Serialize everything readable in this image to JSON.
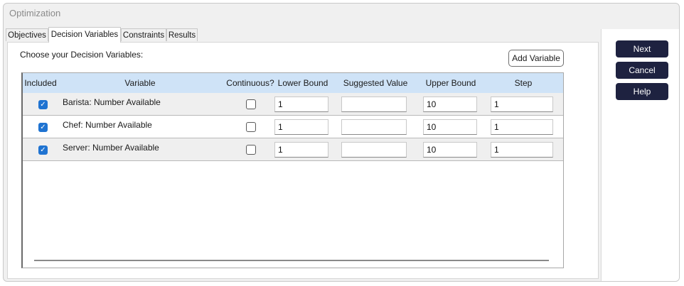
{
  "window": {
    "title": "Optimization"
  },
  "tabs": [
    {
      "label": "Objectives",
      "active": false
    },
    {
      "label": "Decision Variables",
      "active": true
    },
    {
      "label": "Constraints",
      "active": false
    },
    {
      "label": "Results",
      "active": false
    }
  ],
  "panel": {
    "heading": "Choose your Decision Variables:",
    "add_button": "Add Variable"
  },
  "grid": {
    "columns": [
      "Included",
      "Variable",
      "Continuous?",
      "Lower Bound",
      "Suggested Value",
      "Upper Bound",
      "Step"
    ],
    "rows": [
      {
        "included": true,
        "variable": "Barista: Number Available",
        "continuous": false,
        "lower": "1",
        "suggested": "",
        "upper": "10",
        "step": "1"
      },
      {
        "included": true,
        "variable": "Chef: Number Available",
        "continuous": false,
        "lower": "1",
        "suggested": "",
        "upper": "10",
        "step": "1"
      },
      {
        "included": true,
        "variable": "Server: Number Available",
        "continuous": false,
        "lower": "1",
        "suggested": "",
        "upper": "10",
        "step": "1"
      }
    ]
  },
  "buttons": {
    "next": "Next",
    "cancel": "Cancel",
    "help": "Help"
  },
  "colors": {
    "header_bg": "#cfe3f7",
    "checkbox_checked": "#1f73d1",
    "action_button_bg": "#1e2240"
  }
}
